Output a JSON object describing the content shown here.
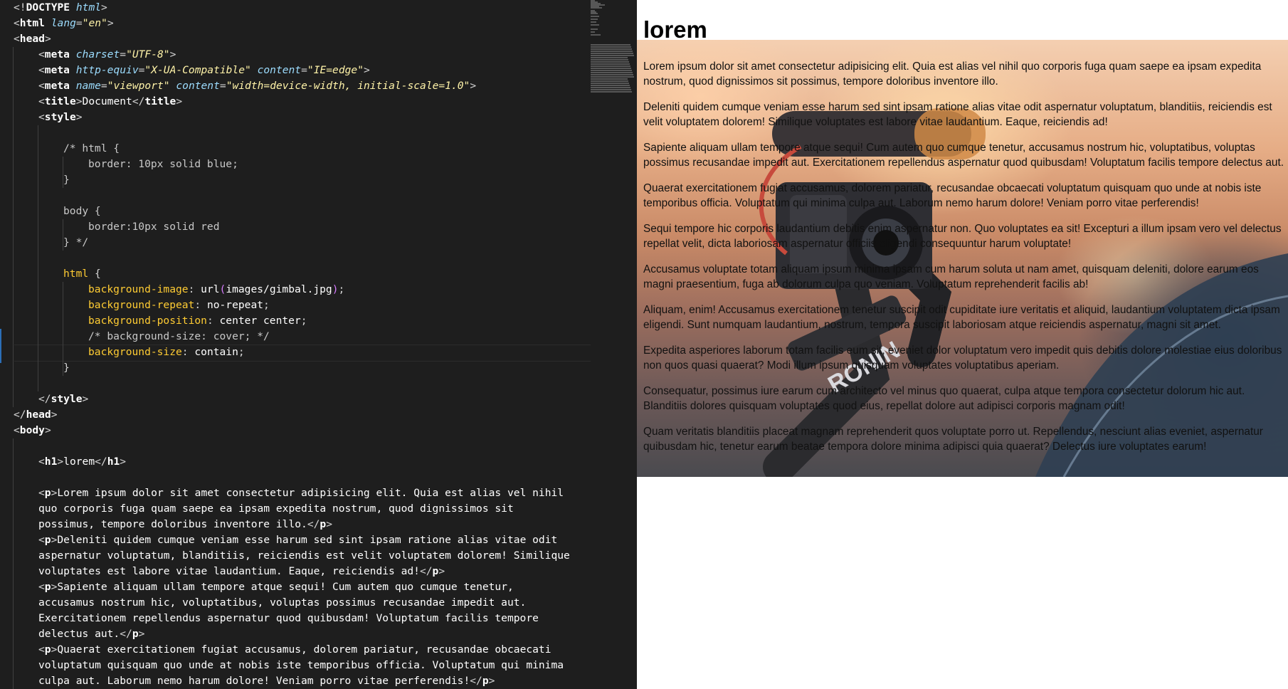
{
  "editor": {
    "lines": [
      [
        {
          "c": "t-punc",
          "t": "<!"
        },
        {
          "c": "t-tag",
          "t": "DOCTYPE"
        },
        {
          "c": "t-punc",
          "t": " "
        },
        {
          "c": "t-attr",
          "t": "html"
        },
        {
          "c": "t-punc",
          "t": ">"
        }
      ],
      [
        {
          "c": "t-punc",
          "t": "<"
        },
        {
          "c": "t-tag",
          "t": "html"
        },
        {
          "c": "t-punc",
          "t": " "
        },
        {
          "c": "t-attr",
          "t": "lang"
        },
        {
          "c": "t-punc",
          "t": "="
        },
        {
          "c": "t-str",
          "t": "\"en\""
        },
        {
          "c": "t-punc",
          "t": ">"
        }
      ],
      [
        {
          "c": "t-punc",
          "t": "<"
        },
        {
          "c": "t-tag",
          "t": "head"
        },
        {
          "c": "t-punc",
          "t": ">"
        }
      ],
      [
        {
          "c": "t-punc",
          "t": "<"
        },
        {
          "c": "t-tag",
          "t": "meta"
        },
        {
          "c": "t-punc",
          "t": " "
        },
        {
          "c": "t-attr",
          "t": "charset"
        },
        {
          "c": "t-punc",
          "t": "="
        },
        {
          "c": "t-str",
          "t": "\"UTF-8\""
        },
        {
          "c": "t-punc",
          "t": ">"
        }
      ],
      [
        {
          "c": "t-punc",
          "t": "<"
        },
        {
          "c": "t-tag",
          "t": "meta"
        },
        {
          "c": "t-punc",
          "t": " "
        },
        {
          "c": "t-attr",
          "t": "http-equiv"
        },
        {
          "c": "t-punc",
          "t": "="
        },
        {
          "c": "t-str",
          "t": "\"X-UA-Compatible\""
        },
        {
          "c": "t-punc",
          "t": " "
        },
        {
          "c": "t-attr",
          "t": "content"
        },
        {
          "c": "t-punc",
          "t": "="
        },
        {
          "c": "t-str",
          "t": "\"IE=edge\""
        },
        {
          "c": "t-punc",
          "t": ">"
        }
      ],
      [
        {
          "c": "t-punc",
          "t": "<"
        },
        {
          "c": "t-tag",
          "t": "meta"
        },
        {
          "c": "t-punc",
          "t": " "
        },
        {
          "c": "t-attr",
          "t": "name"
        },
        {
          "c": "t-punc",
          "t": "="
        },
        {
          "c": "t-str",
          "t": "\"viewport\""
        },
        {
          "c": "t-punc",
          "t": " "
        },
        {
          "c": "t-attr",
          "t": "content"
        },
        {
          "c": "t-punc",
          "t": "="
        },
        {
          "c": "t-str",
          "t": "\"width=device-width, initial-scale=1.0\""
        },
        {
          "c": "t-punc",
          "t": ">"
        }
      ],
      [
        {
          "c": "t-punc",
          "t": "<"
        },
        {
          "c": "t-tag",
          "t": "title"
        },
        {
          "c": "t-punc",
          "t": ">"
        },
        {
          "c": "t-text",
          "t": "Document"
        },
        {
          "c": "t-punc",
          "t": "</"
        },
        {
          "c": "t-tag",
          "t": "title"
        },
        {
          "c": "t-punc",
          "t": ">"
        }
      ],
      [
        {
          "c": "t-punc",
          "t": "<"
        },
        {
          "c": "t-tag",
          "t": "style"
        },
        {
          "c": "t-punc",
          "t": ">"
        }
      ],
      [],
      [
        {
          "c": "t-com",
          "t": "/* html {"
        }
      ],
      [
        {
          "c": "t-com",
          "t": "border: 10px solid blue;"
        }
      ],
      [
        {
          "c": "t-com",
          "t": "}"
        }
      ],
      [],
      [
        {
          "c": "t-com",
          "t": "body {"
        }
      ],
      [
        {
          "c": "t-com",
          "t": "border:10px solid red"
        }
      ],
      [
        {
          "c": "t-com",
          "t": "} */"
        }
      ],
      [],
      [
        {
          "c": "t-sel",
          "t": "html "
        },
        {
          "c": "t-punc",
          "t": "{"
        }
      ],
      [
        {
          "c": "t-prop",
          "t": "background-image"
        },
        {
          "c": "t-punc",
          "t": ": "
        },
        {
          "c": "t-fn",
          "t": "url"
        },
        {
          "c": "t-paren",
          "t": "("
        },
        {
          "c": "t-val",
          "t": "images/gimbal.jpg"
        },
        {
          "c": "t-paren",
          "t": ")"
        },
        {
          "c": "t-punc",
          "t": ";"
        }
      ],
      [
        {
          "c": "t-prop",
          "t": "background-repeat"
        },
        {
          "c": "t-punc",
          "t": ": "
        },
        {
          "c": "t-val",
          "t": "no-repeat"
        },
        {
          "c": "t-punc",
          "t": ";"
        }
      ],
      [
        {
          "c": "t-prop",
          "t": "background-position"
        },
        {
          "c": "t-punc",
          "t": ": "
        },
        {
          "c": "t-val",
          "t": "center center"
        },
        {
          "c": "t-punc",
          "t": ";"
        }
      ],
      [
        {
          "c": "t-com",
          "t": "/* background-size: cover; */"
        }
      ],
      [
        {
          "c": "t-prop",
          "t": "background-size"
        },
        {
          "c": "t-punc",
          "t": ": "
        },
        {
          "c": "t-val",
          "t": "contain"
        },
        {
          "c": "t-punc",
          "t": ";"
        }
      ],
      [
        {
          "c": "t-punc",
          "t": "}"
        }
      ],
      [],
      [
        {
          "c": "t-punc",
          "t": "</"
        },
        {
          "c": "t-tag",
          "t": "style"
        },
        {
          "c": "t-punc",
          "t": ">"
        }
      ],
      [
        {
          "c": "t-punc",
          "t": "</"
        },
        {
          "c": "t-tag",
          "t": "head"
        },
        {
          "c": "t-punc",
          "t": ">"
        }
      ],
      [
        {
          "c": "t-punc",
          "t": "<"
        },
        {
          "c": "t-tag",
          "t": "body"
        },
        {
          "c": "t-punc",
          "t": ">"
        }
      ],
      [],
      [
        {
          "c": "t-punc",
          "t": "<"
        },
        {
          "c": "t-tag",
          "t": "h1"
        },
        {
          "c": "t-punc",
          "t": ">"
        },
        {
          "c": "t-text",
          "t": "lorem"
        },
        {
          "c": "t-punc",
          "t": "</"
        },
        {
          "c": "t-tag",
          "t": "h1"
        },
        {
          "c": "t-punc",
          "t": ">"
        }
      ],
      [],
      [
        {
          "c": "t-punc",
          "t": "<"
        },
        {
          "c": "t-tag",
          "t": "p"
        },
        {
          "c": "t-punc",
          "t": ">"
        },
        {
          "c": "t-text",
          "t": "Lorem ipsum dolor sit amet consectetur adipisicing elit. Quia est alias vel nihil"
        }
      ],
      [
        {
          "c": "t-text",
          "t": "quo corporis fuga quam saepe ea ipsam expedita nostrum, quod dignissimos sit"
        }
      ],
      [
        {
          "c": "t-text",
          "t": "possimus, tempore doloribus inventore illo."
        },
        {
          "c": "t-punc",
          "t": "</"
        },
        {
          "c": "t-tag",
          "t": "p"
        },
        {
          "c": "t-punc",
          "t": ">"
        }
      ],
      [
        {
          "c": "t-punc",
          "t": "<"
        },
        {
          "c": "t-tag",
          "t": "p"
        },
        {
          "c": "t-punc",
          "t": ">"
        },
        {
          "c": "t-text",
          "t": "Deleniti quidem cumque veniam esse harum sed sint ipsam ratione alias vitae odit"
        }
      ],
      [
        {
          "c": "t-text",
          "t": "aspernatur voluptatum, blanditiis, reiciendis est velit voluptatem dolorem! Similique"
        }
      ],
      [
        {
          "c": "t-text",
          "t": "voluptates est labore vitae laudantium. Eaque, reiciendis ad!"
        },
        {
          "c": "t-punc",
          "t": "</"
        },
        {
          "c": "t-tag",
          "t": "p"
        },
        {
          "c": "t-punc",
          "t": ">"
        }
      ],
      [
        {
          "c": "t-punc",
          "t": "<"
        },
        {
          "c": "t-tag",
          "t": "p"
        },
        {
          "c": "t-punc",
          "t": ">"
        },
        {
          "c": "t-text",
          "t": "Sapiente aliquam ullam tempore atque sequi! Cum autem quo cumque tenetur,"
        }
      ],
      [
        {
          "c": "t-text",
          "t": "accusamus nostrum hic, voluptatibus, voluptas possimus recusandae impedit aut."
        }
      ],
      [
        {
          "c": "t-text",
          "t": "Exercitationem repellendus aspernatur quod quibusdam! Voluptatum facilis tempore"
        }
      ],
      [
        {
          "c": "t-text",
          "t": "delectus aut."
        },
        {
          "c": "t-punc",
          "t": "</"
        },
        {
          "c": "t-tag",
          "t": "p"
        },
        {
          "c": "t-punc",
          "t": ">"
        }
      ],
      [
        {
          "c": "t-punc",
          "t": "<"
        },
        {
          "c": "t-tag",
          "t": "p"
        },
        {
          "c": "t-punc",
          "t": ">"
        },
        {
          "c": "t-text",
          "t": "Quaerat exercitationem fugiat accusamus, dolorem pariatur, recusandae obcaecati"
        }
      ],
      [
        {
          "c": "t-text",
          "t": "voluptatum quisquam quo unde at nobis iste temporibus officia. Voluptatum qui minima"
        }
      ],
      [
        {
          "c": "t-text",
          "t": "culpa aut. Laborum nemo harum dolore! Veniam porro vitae perferendis!"
        },
        {
          "c": "t-punc",
          "t": "</"
        },
        {
          "c": "t-tag",
          "t": "p"
        },
        {
          "c": "t-punc",
          "t": ">"
        }
      ]
    ]
  },
  "preview": {
    "heading": "lorem",
    "paragraphs": [
      "Lorem ipsum dolor sit amet consectetur adipisicing elit. Quia est alias vel nihil quo corporis fuga quam saepe ea ipsam expedita nostrum, quod dignissimos sit possimus, tempore doloribus inventore illo.",
      "Deleniti quidem cumque veniam esse harum sed sint ipsam ratione alias vitae odit aspernatur voluptatum, blanditiis, reiciendis est velit voluptatem dolorem! Similique voluptates est labore vitae laudantium. Eaque, reiciendis ad!",
      "Sapiente aliquam ullam tempore atque sequi! Cum autem quo cumque tenetur, accusamus nostrum hic, voluptatibus, voluptas possimus recusandae impedit aut. Exercitationem repellendus aspernatur quod quibusdam! Voluptatum facilis tempore delectus aut.",
      "Quaerat exercitationem fugiat accusamus, dolorem pariatur, recusandae obcaecati voluptatum quisquam quo unde at nobis iste temporibus officia. Voluptatum qui minima culpa aut. Laborum nemo harum dolore! Veniam porro vitae perferendis!",
      "Sequi tempore hic corporis laudantium debitis enim aspernatur non. Quo voluptates ea sit! Excepturi a illum ipsam vero vel delectus repellat velit, dicta laboriosam aspernatur officiis eligendi consequuntur harum voluptate!",
      "Accusamus voluptate totam aliquam ipsum minima ipsam cum harum soluta ut nam amet, quisquam deleniti, dolore earum eos magni praesentium, fuga ab dolorum culpa quo veniam. Voluptatum reprehenderit facilis ab!",
      "Aliquam, enim! Accusamus exercitationem tenetur suscipit odit cupiditate iure veritatis et aliquid, laudantium voluptatem dicta ipsam eligendi. Sunt numquam laudantium, nostrum, tempora suscipit laboriosam atque reiciendis aspernatur, magni sit amet.",
      "Expedita asperiores laborum totam facilis eum sit, eveniet dolor voluptatum vero impedit quis debitis dolore molestiae eius doloribus non quos quasi quaerat? Modi illum ipsum quisquam voluptates voluptatibus aperiam.",
      "Consequatur, possimus iure earum cum architecto vel minus quo quaerat, culpa atque tempora consectetur dolorum hic aut. Blanditiis dolores quisquam voluptates quod eius, repellat dolore aut adipisci corporis magnam odit!",
      "Quam veritatis blanditiis placeat magnam reprehenderit quos voluptate porro ut. Repellendus, nesciunt alias eveniet, aspernatur quibusdam hic, tenetur earum beatae tempora dolore minima adipisci quia quaerat? Delectus iure voluptates earum!"
    ],
    "photo_label": "RONIN"
  },
  "colors": {
    "editor_bg": "#1e1e1e",
    "preview_bg": "#ffffff",
    "tag": "#ffffff",
    "attribute": "#9cdcfe",
    "string": "#fff3a8",
    "css_property": "#ffcc33"
  }
}
